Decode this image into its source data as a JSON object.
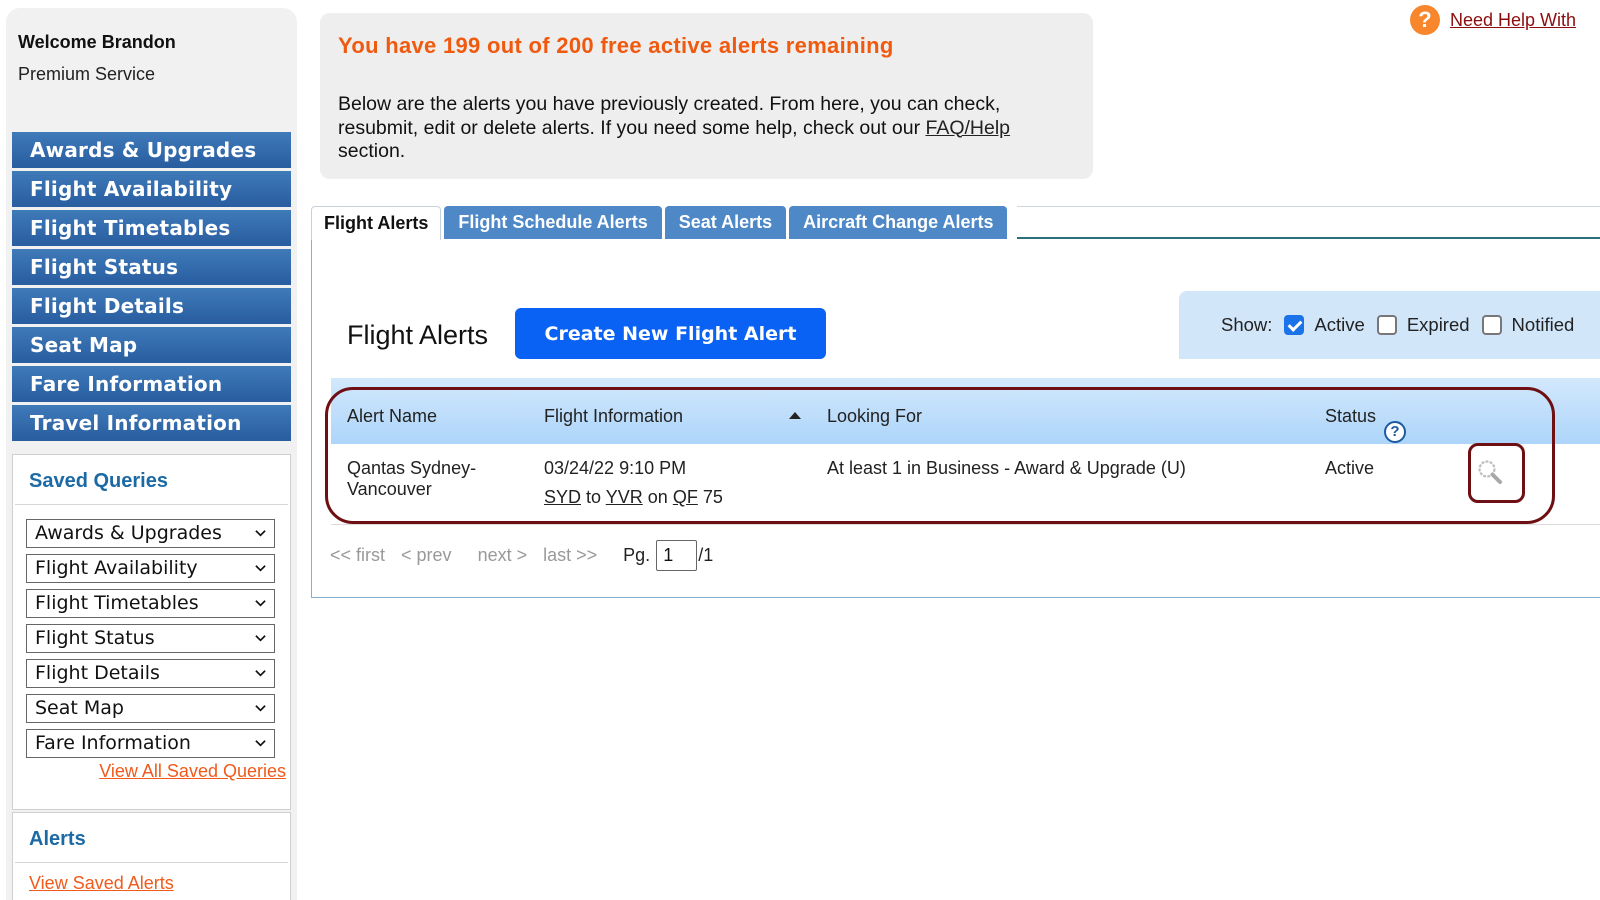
{
  "sidebar": {
    "welcome": "Welcome Brandon",
    "service": "Premium Service",
    "nav": [
      {
        "label": "Awards & Upgrades"
      },
      {
        "label": "Flight Availability"
      },
      {
        "label": "Flight Timetables"
      },
      {
        "label": "Flight Status"
      },
      {
        "label": "Flight Details"
      },
      {
        "label": "Seat Map"
      },
      {
        "label": "Fare Information"
      },
      {
        "label": "Travel Information"
      }
    ],
    "saved_queries": {
      "title": "Saved Queries",
      "selects": [
        {
          "value": "Awards & Upgrades"
        },
        {
          "value": "Flight Availability"
        },
        {
          "value": "Flight Timetables"
        },
        {
          "value": "Flight Status"
        },
        {
          "value": "Flight Details"
        },
        {
          "value": "Seat Map"
        },
        {
          "value": "Fare Information"
        }
      ],
      "view_all": "View All Saved Queries"
    },
    "alerts": {
      "title": "Alerts",
      "link": "View Saved Alerts"
    }
  },
  "help": {
    "icon": "question-icon",
    "label": "Need Help With"
  },
  "notice": {
    "title": "You have 199 out of 200 free active alerts remaining",
    "body_before": "Below are the alerts you have previously created. From here, you can check, resubmit, edit or delete alerts. If you need some help, check out our ",
    "body_link": "FAQ/Help",
    "body_after": " section."
  },
  "tabs": [
    {
      "label": "Flight Alerts",
      "active": true
    },
    {
      "label": "Flight Schedule Alerts",
      "active": false
    },
    {
      "label": "Seat Alerts",
      "active": false
    },
    {
      "label": "Aircraft Change Alerts",
      "active": false
    }
  ],
  "main": {
    "title": "Flight Alerts",
    "create_button": "Create New Flight Alert",
    "show": {
      "label": "Show:",
      "options": [
        {
          "label": "Active",
          "checked": true
        },
        {
          "label": "Expired",
          "checked": false
        },
        {
          "label": "Notified",
          "checked": false
        }
      ]
    },
    "table": {
      "columns": [
        "Alert Name",
        "Flight Information",
        "Looking For",
        "Status"
      ],
      "rows": [
        {
          "alert_name": "Qantas Sydney-Vancouver",
          "date_time": "03/24/22 9:10 PM",
          "origin": "SYD",
          "to": "to",
          "destination": "YVR",
          "on": "on",
          "carrier": "QF",
          "flight_number": "75",
          "looking_for": "At least 1 in Business - Award & Upgrade (U)",
          "status": "Active",
          "action_icon": "search-icon"
        }
      ]
    },
    "pager": {
      "first": "<< first",
      "prev": "< prev",
      "next": "next >",
      "last": "last >>",
      "page_label": "Pg.",
      "page_value": "1",
      "page_total": "/1"
    }
  }
}
